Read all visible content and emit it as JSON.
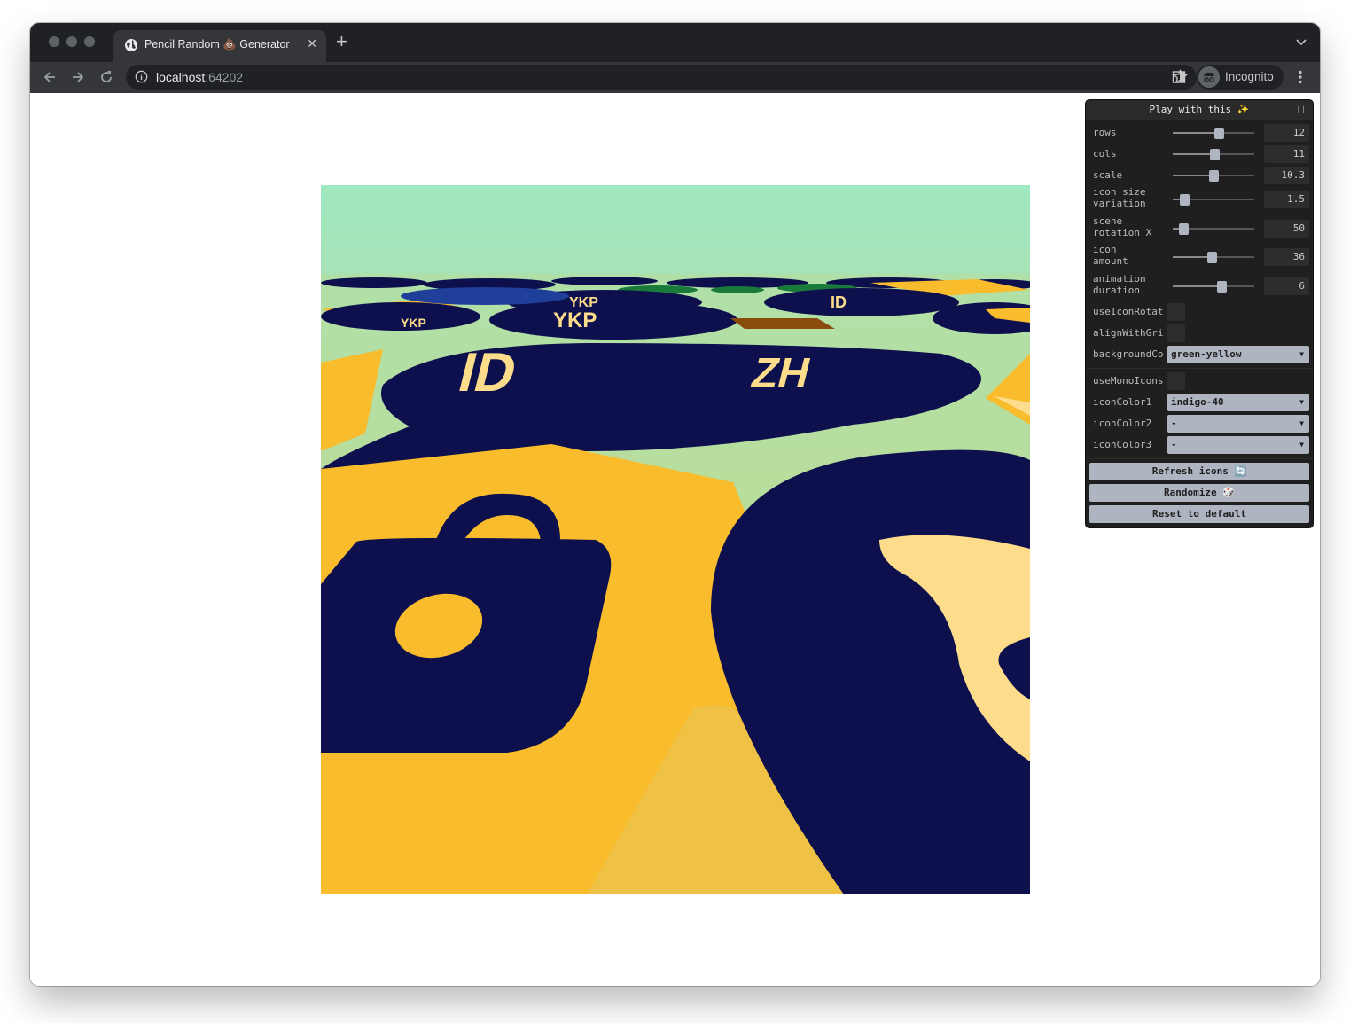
{
  "browser": {
    "tab_title": "Pencil Random 💩 Generator",
    "tab_close": "✕",
    "new_tab": "+",
    "url_host": "localhost",
    "url_port": ":64202",
    "profile_label": "Incognito"
  },
  "gui": {
    "title": "Play with this ✨",
    "collapse": "❘❘",
    "sliders": [
      {
        "label": "rows",
        "value": "12",
        "fraction": 0.57
      },
      {
        "label": "cols",
        "value": "11",
        "fraction": 0.52
      },
      {
        "label": "scale",
        "value": "10.3",
        "fraction": 0.51
      },
      {
        "label": "icon size\nvariation",
        "value": "1.5",
        "fraction": 0.15
      },
      {
        "label": "scene\nrotation X",
        "value": "50",
        "fraction": 0.14
      },
      {
        "label": "icon\namount",
        "value": "36",
        "fraction": 0.48
      },
      {
        "label": "animation\nduration",
        "value": "6",
        "fraction": 0.6
      }
    ],
    "toggles": [
      {
        "label": "useIconRotation"
      },
      {
        "label": "alignWithGrid"
      }
    ],
    "background_color": {
      "label": "backgroundColor",
      "value": "green-yellow"
    },
    "use_mono_icons": {
      "label": "useMonoIcons"
    },
    "icon_colors": [
      {
        "label": "iconColor1",
        "value": "indigo-40"
      },
      {
        "label": "iconColor2",
        "value": "-"
      },
      {
        "label": "iconColor3",
        "value": "-"
      }
    ],
    "buttons": {
      "refresh": "Refresh icons 🔄",
      "randomize": "Randomize 🎲",
      "reset": "Reset to default"
    }
  },
  "scene": {
    "ticket_text_left": "ID",
    "ticket_text_right": "ZH",
    "far_label": "YKP",
    "colors": {
      "sky": "#9fe7bf",
      "ground": "#bddc8d",
      "indigo": "#0d104d",
      "yellow": "#f9bc2d",
      "cream": "#fddc8b"
    }
  }
}
